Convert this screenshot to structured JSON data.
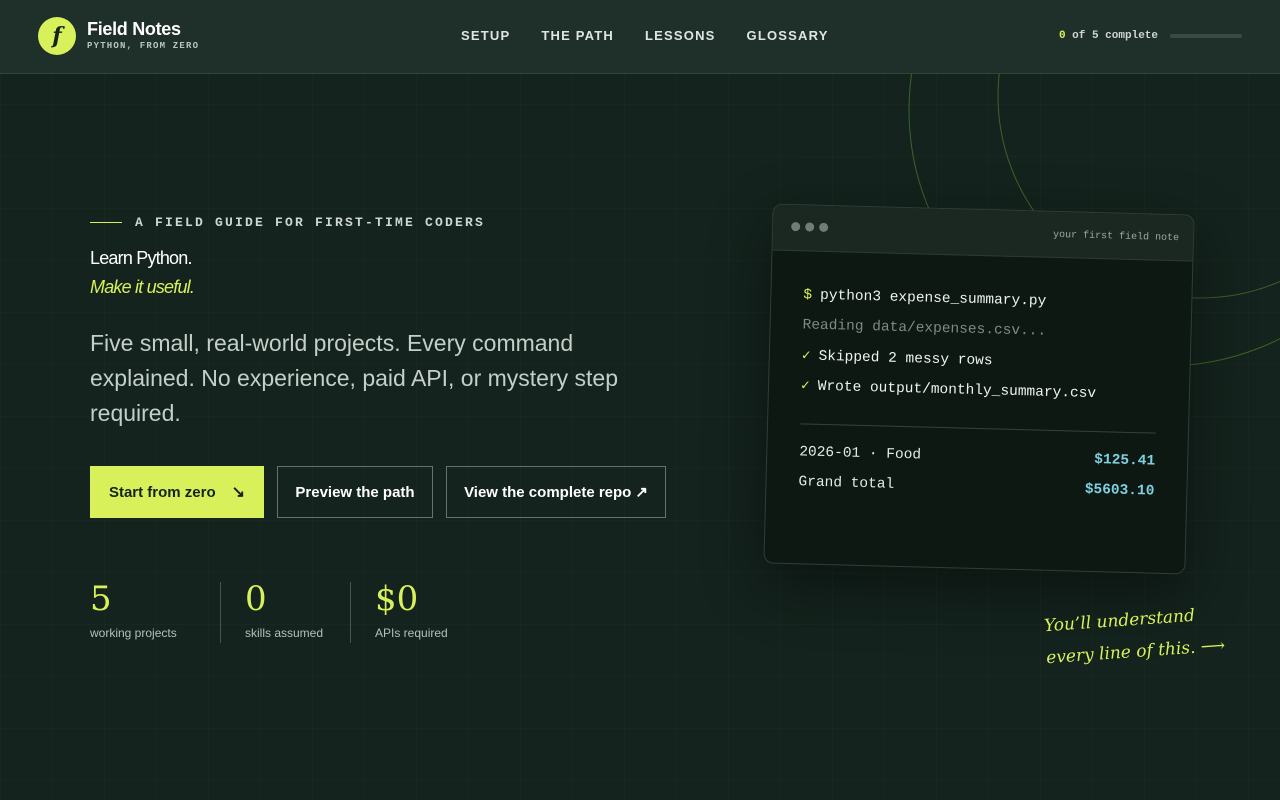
{
  "brand": {
    "logo_letter": "f",
    "name": "Field Notes",
    "tagline": "PYTHON, FROM ZERO"
  },
  "nav": {
    "items": [
      {
        "label": "SETUP"
      },
      {
        "label": "THE PATH"
      },
      {
        "label": "LESSONS"
      },
      {
        "label": "GLOSSARY"
      }
    ]
  },
  "progress": {
    "count": "0",
    "text": " of 5 complete",
    "fraction": 0
  },
  "hero": {
    "eyebrow": "A FIELD GUIDE FOR FIRST-TIME CODERS",
    "title_line1": "Learn Python.",
    "title_line2": "Make it useful.",
    "lede": "Five small, real-world projects. Every command explained. No experience, paid API, or mystery step required."
  },
  "buttons": {
    "primary": {
      "label": "Start from zero",
      "icon": "↘"
    },
    "preview": {
      "label": "Preview the path"
    },
    "repo": {
      "label": "View the complete repo",
      "icon": "↗"
    }
  },
  "stats": [
    {
      "value": "5",
      "label": "working projects"
    },
    {
      "value": "0",
      "label": "skills assumed"
    },
    {
      "value": "$0",
      "label": "APIs required"
    }
  ],
  "terminal": {
    "title": "your first field note",
    "prompt": "$",
    "command": "python3 expense_summary.py",
    "reading": "Reading data/expenses.csv...",
    "check_icon": "✓",
    "line_skipped": "Skipped 2 messy rows",
    "line_wrote": "Wrote output/monthly_summary.csv",
    "summary": [
      {
        "label": "2026-01 · Food",
        "amount": "$125.41"
      },
      {
        "label": "Grand total",
        "amount": "$5603.10"
      }
    ]
  },
  "note": {
    "line1": "You’ll understand",
    "line2": "every line of this."
  },
  "colors": {
    "accent": "#d8f05a",
    "background": "#14231d",
    "money": "#7ed0e0"
  }
}
